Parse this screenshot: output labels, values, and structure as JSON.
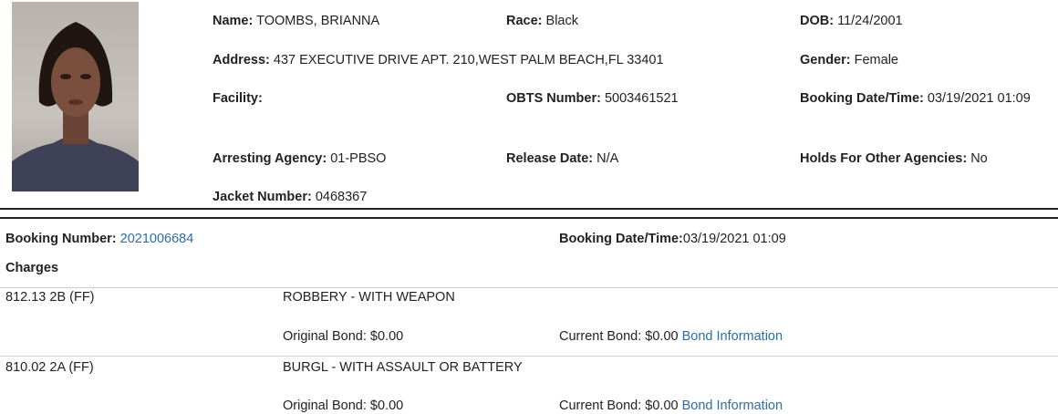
{
  "inmate": {
    "photo_icon": "mugshot-photo",
    "name_label": "Name:",
    "name": "TOOMBS, BRIANNA",
    "race_label": "Race:",
    "race": "Black",
    "dob_label": "DOB:",
    "dob": "11/24/2001",
    "address_label": "Address:",
    "address": "437 EXECUTIVE DRIVE APT. 210,WEST PALM BEACH,FL 33401",
    "gender_label": "Gender:",
    "gender": "Female",
    "facility_label": "Facility:",
    "facility": "",
    "obts_label": "OBTS Number:",
    "obts": "5003461521",
    "booking_dt_label": "Booking Date/Time:",
    "booking_dt": "03/19/2021 01:09",
    "agency_label": "Arresting Agency:",
    "agency": "01-PBSO",
    "release_label": "Release Date:",
    "release": "N/A",
    "holds_label": "Holds For Other Agencies:",
    "holds": "No",
    "jacket_label": "Jacket Number:",
    "jacket": "0468367"
  },
  "booking": {
    "number_label": "Booking Number:",
    "number": "2021006684",
    "dt_label": "Booking Date/Time:",
    "dt": "03/19/2021 01:09",
    "charges_heading": "Charges"
  },
  "charges": [
    {
      "statute": "812.13 2B (FF)",
      "description": "ROBBERY - WITH WEAPON",
      "original_bond": "Original Bond: $0.00",
      "current_bond": "Current Bond: $0.00",
      "bond_link": "Bond Information"
    },
    {
      "statute": "810.02 2A (FF)",
      "description": "BURGL - WITH ASSAULT OR BATTERY",
      "original_bond": "Original Bond: $0.00",
      "current_bond": "Current Bond: $0.00",
      "bond_link": "Bond Information"
    }
  ]
}
